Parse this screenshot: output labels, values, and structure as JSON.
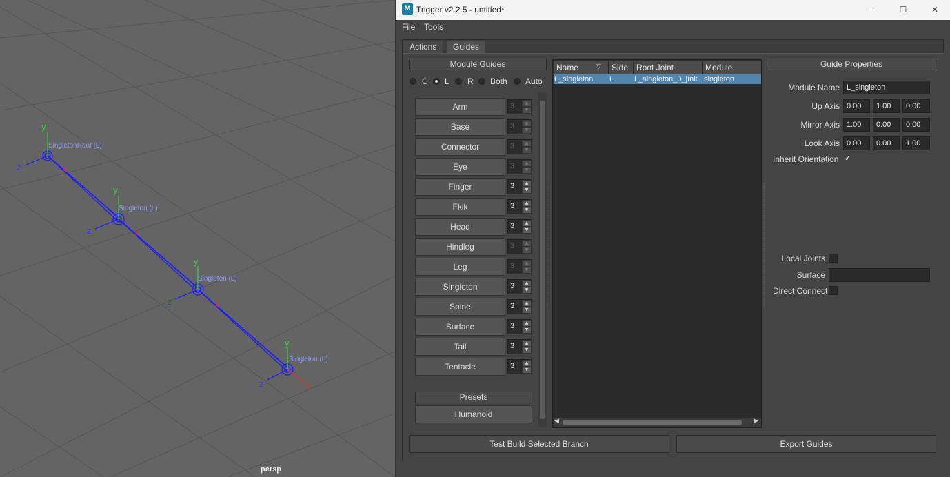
{
  "viewport": {
    "camera": "persp",
    "joint_labels": [
      "SingletonRoot (L)",
      "Singleton (L)",
      "Singleton (L)",
      "Singleton (L)"
    ],
    "axes": {
      "y": "y",
      "z": "z",
      "x": "x"
    }
  },
  "window": {
    "title": "Trigger v2.2.5 - untitled*",
    "app_icon": "maya-icon",
    "app_icon_text": "M",
    "minimize_glyph": "—",
    "maximize_glyph": "☐",
    "close_glyph": "✕"
  },
  "menu": {
    "file": "File",
    "tools": "Tools"
  },
  "tabs": {
    "actions": "Actions",
    "guides": "Guides"
  },
  "module_guides": {
    "header": "Module Guides",
    "sides": [
      {
        "label": "C",
        "checked": false
      },
      {
        "label": "L",
        "checked": true
      },
      {
        "label": "R",
        "checked": false
      },
      {
        "label": "Both",
        "checked": false
      },
      {
        "label": "Auto",
        "checked": false
      }
    ],
    "modules": [
      {
        "label": "Arm",
        "count": "3",
        "enabled": false
      },
      {
        "label": "Base",
        "count": "3",
        "enabled": false
      },
      {
        "label": "Connector",
        "count": "3",
        "enabled": false
      },
      {
        "label": "Eye",
        "count": "3",
        "enabled": false
      },
      {
        "label": "Finger",
        "count": "3",
        "enabled": true
      },
      {
        "label": "Fkik",
        "count": "3",
        "enabled": true
      },
      {
        "label": "Head",
        "count": "3",
        "enabled": true
      },
      {
        "label": "Hindleg",
        "count": "3",
        "enabled": false
      },
      {
        "label": "Leg",
        "count": "3",
        "enabled": false
      },
      {
        "label": "Singleton",
        "count": "3",
        "enabled": true
      },
      {
        "label": "Spine",
        "count": "3",
        "enabled": true
      },
      {
        "label": "Surface",
        "count": "3",
        "enabled": true
      },
      {
        "label": "Tail",
        "count": "3",
        "enabled": true
      },
      {
        "label": "Tentacle",
        "count": "3",
        "enabled": true
      }
    ],
    "spin_up_glyph": "▲",
    "spin_down_glyph": "▼",
    "presets_header": "Presets",
    "presets": [
      "Humanoid"
    ]
  },
  "guides_table": {
    "columns": [
      "Name",
      "Side",
      "Root Joint",
      "Module"
    ],
    "sort_glyph": "▽",
    "rows": [
      {
        "name": "L_singleton",
        "side": "L",
        "root_joint": "L_singleton_0_jInit",
        "module": "singleton"
      }
    ],
    "scroll_left_glyph": "◀",
    "scroll_right_glyph": "▶"
  },
  "properties": {
    "header": "Guide Properties",
    "module_name_label": "Module Name",
    "module_name": "L_singleton",
    "up_axis_label": "Up Axis",
    "up_axis": [
      "0.00",
      "1.00",
      "0.00"
    ],
    "mirror_axis_label": "Mirror Axis",
    "mirror_axis": [
      "1.00",
      "0.00",
      "0.00"
    ],
    "look_axis_label": "Look Axis",
    "look_axis": [
      "0.00",
      "0.00",
      "1.00"
    ],
    "inherit_orientation_label": "Inherit Orientation",
    "inherit_orientation": true,
    "check_glyph": "✓",
    "local_joints_label": "Local Joints",
    "local_joints": false,
    "surface_label": "Surface",
    "surface": "",
    "direct_connect_label": "Direct Connect",
    "direct_connect": false
  },
  "footer": {
    "test_build": "Test Build Selected Branch",
    "export": "Export Guides"
  }
}
